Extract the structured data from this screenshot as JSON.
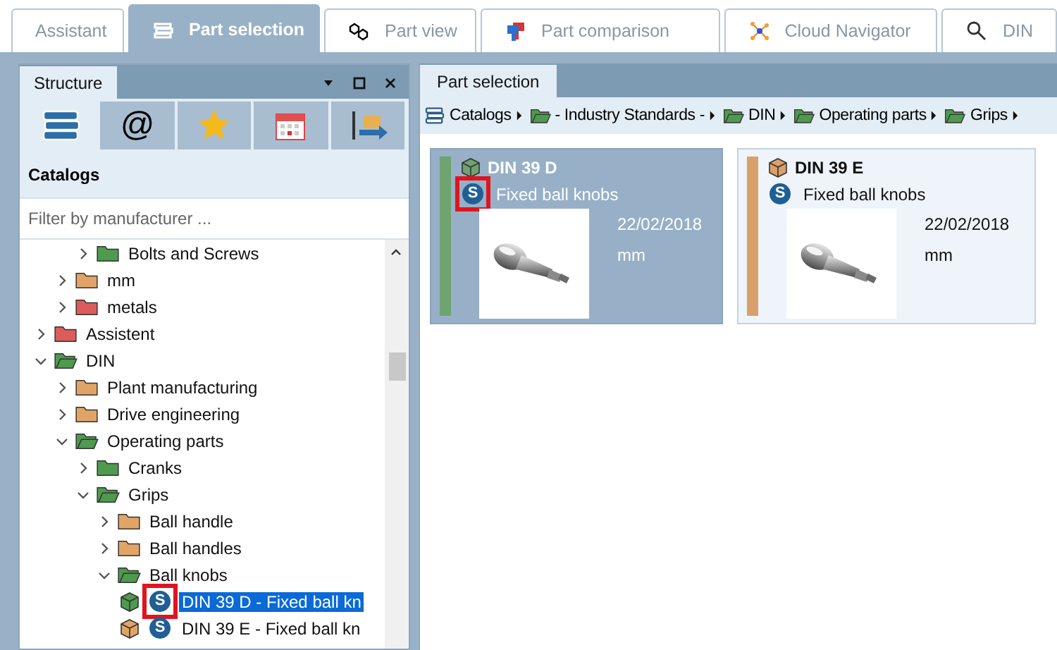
{
  "tabs": [
    {
      "label": "Assistant",
      "selected": false
    },
    {
      "label": "Part selection",
      "selected": true
    },
    {
      "label": "Part view",
      "selected": false
    },
    {
      "label": "Part comparison",
      "selected": false
    },
    {
      "label": "Cloud Navigator",
      "selected": false
    },
    {
      "label": "DIN",
      "selected": false
    }
  ],
  "left_panel": {
    "tab": "Structure",
    "toolbar": [
      {
        "selected": true
      },
      {
        "selected": false,
        "label": "@"
      },
      {
        "selected": false
      },
      {
        "selected": false
      },
      {
        "selected": false
      }
    ],
    "heading": "Catalogs",
    "filter": {
      "placeholder": "Filter by manufacturer ..."
    },
    "tree": [
      {
        "children": [
          {
            "children": [
              {
                "label": "Bolts and Screws",
                "kind": "folder",
                "color": "#4e9a4e",
                "expanded": false
              }
            ]
          },
          {
            "label": "mm",
            "kind": "folder",
            "color": "#e2a466",
            "expanded": false
          },
          {
            "label": "metals",
            "kind": "folder",
            "color": "#dc5c5c",
            "expanded": false
          }
        ]
      },
      {
        "label": "Assistent",
        "kind": "folder",
        "color": "#dc5c5c",
        "expanded": false
      },
      {
        "label": "DIN",
        "kind": "folder",
        "color": "#4e9a4e",
        "expanded": true,
        "children": [
          {
            "label": "Plant manufacturing",
            "kind": "folder",
            "color": "#e2a466",
            "expanded": false
          },
          {
            "label": "Drive engineering",
            "kind": "folder",
            "color": "#e2a466",
            "expanded": false
          },
          {
            "label": "Operating parts",
            "kind": "folder",
            "color": "#4e9a4e",
            "expanded": true,
            "children": [
              {
                "label": "Cranks",
                "kind": "folder",
                "color": "#4e9a4e",
                "expanded": false
              },
              {
                "label": "Grips",
                "kind": "folder",
                "color": "#4e9a4e",
                "expanded": true,
                "children": [
                  {
                    "label": "Ball handle",
                    "kind": "folder",
                    "color": "#e2a466",
                    "expanded": false
                  },
                  {
                    "label": "Ball handles",
                    "kind": "folder",
                    "color": "#e2a466",
                    "expanded": false
                  },
                  {
                    "label": "Ball knobs",
                    "kind": "folder",
                    "color": "#4e9a4e",
                    "expanded": true,
                    "children": [
                      {
                        "label": "DIN 39 D - Fixed ball kn",
                        "kind": "part",
                        "color": "#4e9a4e",
                        "badge": "S",
                        "selected": true,
                        "highlighted": true
                      },
                      {
                        "label": "DIN 39 E - Fixed ball kn",
                        "kind": "part",
                        "color": "#e2a466",
                        "badge": "S",
                        "selected": false,
                        "highlighted": false
                      }
                    ]
                  }
                ]
              }
            ]
          }
        ]
      }
    ]
  },
  "right_panel": {
    "tab": "Part selection",
    "breadcrumb": [
      {
        "label": "Catalogs",
        "kind": "catalogs"
      },
      {
        "label": "- Industry Standards -",
        "kind": "folder"
      },
      {
        "label": "DIN",
        "kind": "folder"
      },
      {
        "label": "Operating parts",
        "kind": "folder"
      },
      {
        "label": "Grips",
        "kind": "folder"
      }
    ],
    "cards": [
      {
        "title": "DIN 39 D",
        "description": "Fixed ball knobs",
        "date": "22/02/2018",
        "unit": "mm",
        "badge": "S",
        "color": "#6fa36f",
        "selected": true,
        "highlighted": true
      },
      {
        "title": "DIN 39 E",
        "description": "Fixed ball knobs",
        "date": "22/02/2018",
        "unit": "mm",
        "badge": "S",
        "color": "#d9a06a",
        "selected": false,
        "highlighted": false
      }
    ]
  }
}
